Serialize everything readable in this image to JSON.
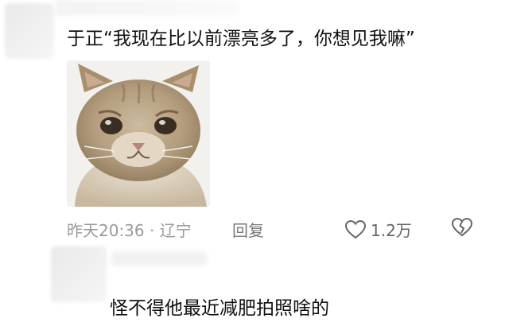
{
  "comment": {
    "text": "于正“我现在比以前漂亮多了，你想见我嘛”",
    "time": "昨天20:36 · 辽宁",
    "reply_label": "回复",
    "likes": "1.2万"
  },
  "reply": {
    "text": "怪不得他最近减肥拍照啥的"
  },
  "icons": {
    "like": "heart-outline-icon",
    "dislike": "broken-heart-icon"
  },
  "colors": {
    "meta_text": "#9a9a9a",
    "body_text": "#111111"
  }
}
